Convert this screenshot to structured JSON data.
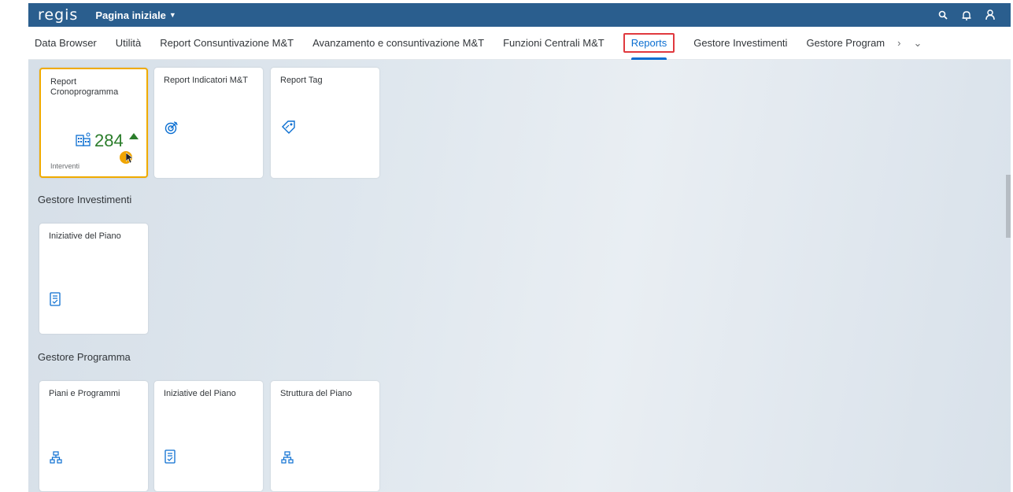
{
  "header": {
    "logo": "regis",
    "home_title": "Pagina iniziale"
  },
  "tabs": [
    {
      "label": "Data Browser"
    },
    {
      "label": "Utilità"
    },
    {
      "label": "Report Consuntivazione M&T"
    },
    {
      "label": "Avanzamento e consuntivazione M&T"
    },
    {
      "label": "Funzioni Centrali M&T"
    },
    {
      "label": "Reports"
    },
    {
      "label": "Gestore Investimenti"
    },
    {
      "label": "Gestore Program"
    }
  ],
  "reports_group": {
    "tiles": [
      {
        "title": "Report Cronoprogramma",
        "kpi_value": "284",
        "footer": "Interventi"
      },
      {
        "title": "Report Indicatori M&T"
      },
      {
        "title": "Report Tag"
      }
    ]
  },
  "gestore_investimenti": {
    "title": "Gestore Investimenti",
    "tiles": [
      {
        "title": "Iniziative del Piano"
      }
    ]
  },
  "gestore_programma": {
    "title": "Gestore Programma",
    "tiles": [
      {
        "title": "Piani e Programmi"
      },
      {
        "title": "Iniziative del Piano"
      },
      {
        "title": "Struttura del Piano"
      }
    ]
  },
  "colors": {
    "header_bg": "#2a5e8e",
    "accent": "#0a6ed1",
    "kpi_green": "#2b7d2b",
    "focus": "#f0ab00",
    "highlight_red": "#e0393e"
  }
}
